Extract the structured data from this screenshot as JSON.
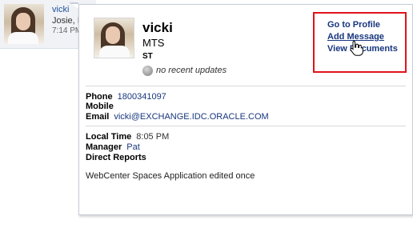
{
  "background_card": {
    "name": "vicki",
    "subtitle": "Josie, I",
    "time": "7:14 PM"
  },
  "profile": {
    "name": "vicki",
    "title": "MTS",
    "department": "ST",
    "status": "no recent updates"
  },
  "actions": {
    "go_to_profile": "Go to Profile",
    "add_message": "Add Message",
    "view_documents": "View Documents"
  },
  "contact": {
    "phone_label": "Phone",
    "phone_value": "1800341097",
    "mobile_label": "Mobile",
    "email_label": "Email",
    "email_value": "vicki@EXCHANGE.IDC.ORACLE.COM"
  },
  "org": {
    "local_time_label": "Local Time",
    "local_time_value": "8:05 PM",
    "manager_label": "Manager",
    "manager_value": "Pat",
    "direct_reports_label": "Direct Reports"
  },
  "activity": "WebCenter Spaces Application edited once",
  "colors": {
    "link": "#17367e",
    "highlight_box": "#e0131c"
  }
}
